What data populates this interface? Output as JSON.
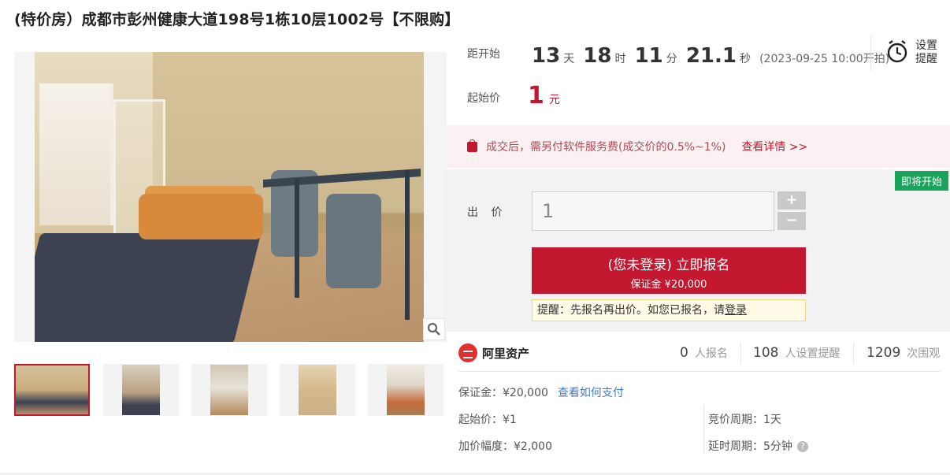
{
  "title": "(特价房）成都市彭州健康大道198号1栋10层1002号【不限购】",
  "countdown": {
    "label": "距开始",
    "days": "13",
    "days_unit": "天",
    "hours": "18",
    "hours_unit": "时",
    "minutes": "11",
    "minutes_unit": "分",
    "seconds": "21.1",
    "seconds_unit": "秒",
    "start_time": "(2023-09-25 10:00开拍)"
  },
  "reminder": {
    "label": "设置提醒",
    "icon": "alarm-clock-icon"
  },
  "start_price": {
    "label": "起始价",
    "value": "1",
    "unit": "元"
  },
  "notice": {
    "text": "成交后，需另付软件服务费(成交价的0.5%~1%)",
    "link": "查看详情 >>"
  },
  "status_badge": "即将开始",
  "bid": {
    "label": "出 价",
    "value": "1",
    "plus": "+",
    "minus": "−",
    "signup_line1": "(您未登录) 立即报名",
    "signup_line2": "保证金 ¥20,000",
    "tip_text": "提醒：先报名再出价。如您已报名，请",
    "tip_link": "登录"
  },
  "platform": {
    "name": "阿里资产"
  },
  "stats": [
    {
      "value": "0",
      "label": "人报名"
    },
    {
      "value": "108",
      "label": "人设置提醒"
    },
    {
      "value": "1209",
      "label": "次围观"
    }
  ],
  "details": {
    "deposit": "保证金：¥20,000",
    "deposit_link": "查看如何支付",
    "start_price": "起始价：¥1",
    "increment": "加价幅度：¥2,000",
    "cycle": "竞价周期：1天",
    "delay": "延时周期：5分钟"
  },
  "colors": {
    "accent": "#c3182f",
    "badge": "#19a35b",
    "link": "#3f7fc9"
  }
}
